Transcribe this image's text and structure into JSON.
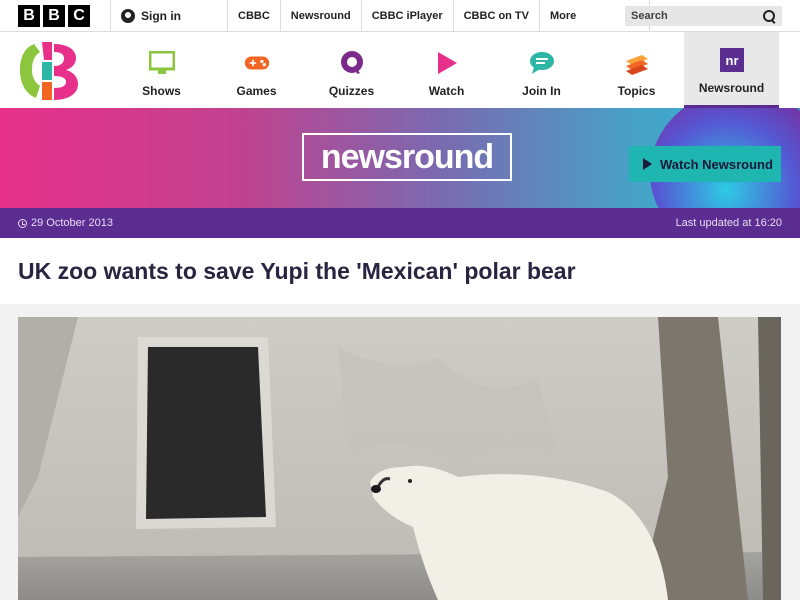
{
  "bbc_bar": {
    "logo_letters": [
      "B",
      "B",
      "C"
    ],
    "signin_label": "Sign in",
    "nav": [
      "CBBC",
      "Newsround",
      "CBBC iPlayer",
      "CBBC on TV"
    ],
    "more_label": "More",
    "search_placeholder": "Search"
  },
  "cbbc_nav": {
    "items": [
      {
        "label": "Shows",
        "icon": "tv-icon",
        "color": "#8cc63e"
      },
      {
        "label": "Games",
        "icon": "gamepad-icon",
        "color": "#f26522"
      },
      {
        "label": "Quizzes",
        "icon": "quiz-icon",
        "color": "#7b2a8c"
      },
      {
        "label": "Watch",
        "icon": "play-icon",
        "color": "#e6308a"
      },
      {
        "label": "Join In",
        "icon": "chat-icon",
        "color": "#2bb6a6"
      },
      {
        "label": "Topics",
        "icon": "stack-icon",
        "color": "#f26522"
      },
      {
        "label": "Newsround",
        "icon": "newsround-icon",
        "color": "#5c2d91",
        "active": true
      }
    ]
  },
  "banner": {
    "logo_text": "newsround",
    "watch_label": "Watch Newsround"
  },
  "date_bar": {
    "date": "29 October 2013",
    "updated": "Last updated at 16:20"
  },
  "article": {
    "headline": "UK zoo wants to save Yupi the 'Mexican' polar bear"
  },
  "colors": {
    "brand_purple": "#5c2d91",
    "watch_teal": "#1fb5b0"
  }
}
